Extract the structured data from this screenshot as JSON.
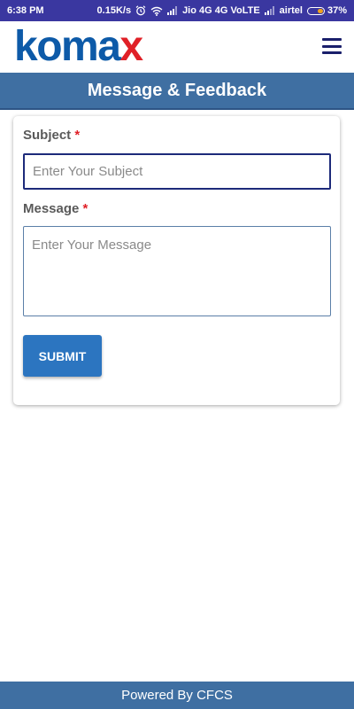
{
  "status_bar": {
    "time": "6:38 PM",
    "net_speed": "0.15K/s",
    "carrier1": "Jio 4G 4G VoLTE",
    "carrier2": "airtel",
    "battery": "37%",
    "icons": [
      "alarm-icon",
      "wifi-icon",
      "signal-icon",
      "signal-icon",
      "battery-icon"
    ]
  },
  "header": {
    "logo_main": "koma",
    "logo_accent": "x",
    "menu_icon": "hamburger-menu-icon"
  },
  "page": {
    "title": "Message & Feedback"
  },
  "form": {
    "subject_label": "Subject",
    "subject_placeholder": "Enter Your Subject",
    "message_label": "Message",
    "message_placeholder": "Enter Your Message",
    "required_mark": "*",
    "submit_label": "SUBMIT"
  },
  "footer": {
    "text": "Powered By CFCS"
  },
  "colors": {
    "status_bar": "#3a37a0",
    "brand_blue": "#0d5aa8",
    "brand_red": "#e02027",
    "title_bar": "#3f6fa2",
    "button": "#2c75c0"
  }
}
